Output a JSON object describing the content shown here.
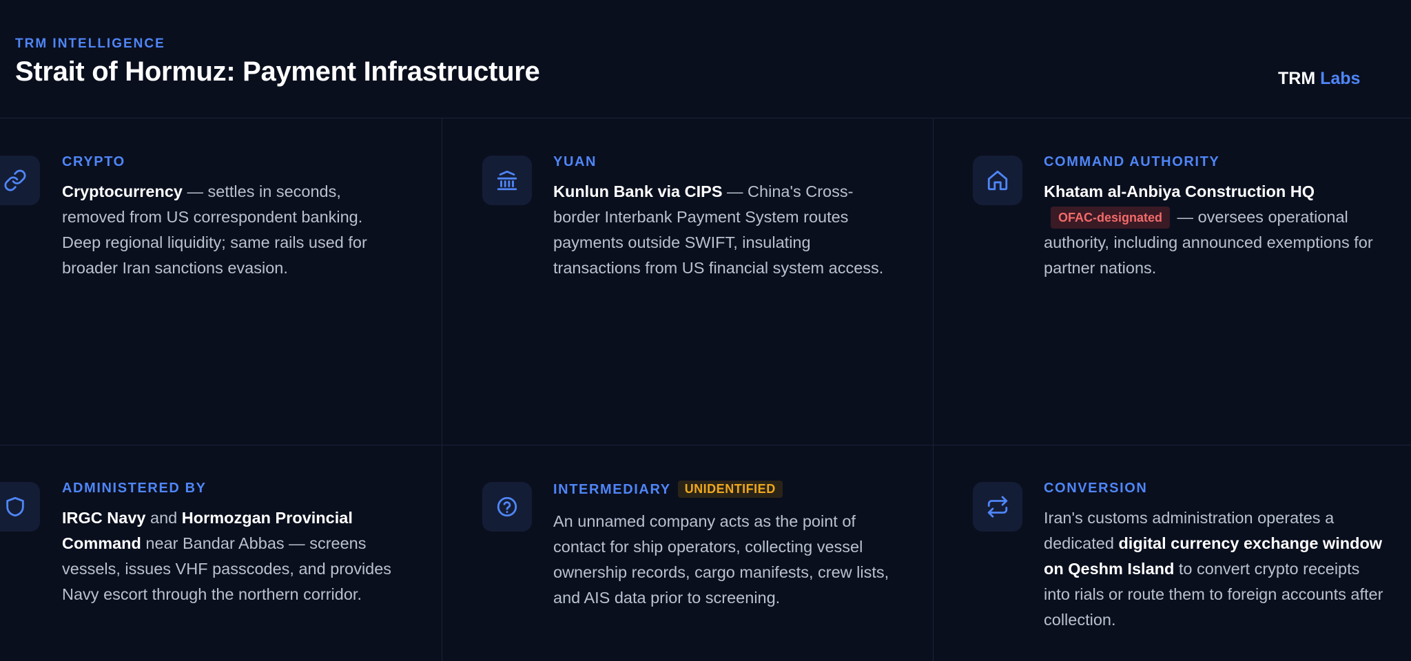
{
  "header": {
    "eyebrow": "TRM INTELLIGENCE",
    "title": "Strait of Hormuz: Payment Infrastructure",
    "brand_main": "TRM",
    "brand_accent": "Labs"
  },
  "colors": {
    "background": "#0a0f1e",
    "accent": "#4f86f7",
    "warning": "#f0a81c",
    "danger": "#f26b6b"
  },
  "cards": {
    "crypto": {
      "icon": "link-icon",
      "label": "CRYPTO",
      "strong": "Cryptocurrency",
      "rest": " — settles in seconds, removed from US correspondent banking. Deep regional liquidity; same rails used for broader Iran sanctions evasion."
    },
    "yuan": {
      "icon": "bank-icon",
      "label": "YUAN",
      "strong": "Kunlun Bank via CIPS",
      "rest": " — China's Cross-border Interbank Payment System routes payments outside SWIFT, insulating transactions from US financial system access."
    },
    "command": {
      "icon": "home-icon",
      "label": "COMMAND AUTHORITY",
      "strong": "Khatam al-Anbiya Construction HQ",
      "badge": "OFAC-designated",
      "rest": " — oversees operational authority, including announced exemptions for partner nations."
    },
    "administered": {
      "icon": "shield-icon",
      "label": "ADMINISTERED BY",
      "strong1": "IRGC Navy",
      "mid": " and ",
      "strong2": "Hormozgan Provincial Command",
      "rest": " near Bandar Abbas — screens vessels, issues VHF passcodes, and provides Navy escort through the northern corridor."
    },
    "intermediary": {
      "icon": "question-circle-icon",
      "label": "INTERMEDIARY",
      "badge": "UNIDENTIFIED",
      "text": "An unnamed company acts as the point of contact for ship operators, collecting vessel ownership records, cargo manifests, crew lists, and AIS data prior to screening."
    },
    "conversion": {
      "icon": "repeat-arrows-icon",
      "label": "CONVERSION",
      "pre": "Iran's customs administration operates a dedicated ",
      "strong": "digital currency exchange window on Qeshm Island",
      "rest": " to convert crypto receipts into rials or route them to foreign accounts after collection."
    }
  }
}
